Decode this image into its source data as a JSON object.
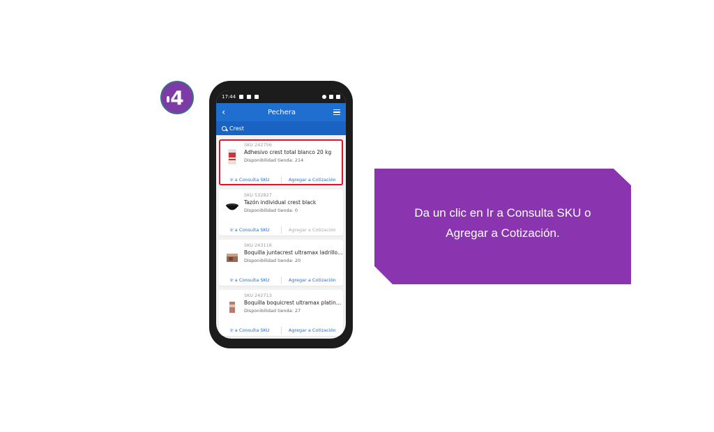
{
  "step": {
    "number": "4"
  },
  "phone": {
    "status": {
      "time": "17:44"
    },
    "app_title": "Pechera",
    "search_value": "Crest",
    "products": [
      {
        "sku": "SKU 242756",
        "name": "Adhesivo crest total blanco 20 kg",
        "stock": "Disponibilidad tienda: 214",
        "consulta": "Ir a Consulta SKU",
        "cotizacion": "Agregar a Cotización",
        "cotizacion_enabled": true,
        "highlighted": true,
        "thumb": "adhesive-bag-icon"
      },
      {
        "sku": "SKU 532827",
        "name": "Tazón individual crest black",
        "stock": "Disponibilidad tienda: 0",
        "consulta": "Ir a Consulta SKU",
        "cotizacion": "Agregar a Cotización",
        "cotizacion_enabled": false,
        "highlighted": false,
        "thumb": "bowl-icon"
      },
      {
        "sku": "SKU 243116",
        "name": "Boquilla juntacrest ultramax ladrillo 5...",
        "stock": "Disponibilidad tienda: 20",
        "consulta": "Ir a Consulta SKU",
        "cotizacion": "Agregar a Cotización",
        "cotizacion_enabled": true,
        "highlighted": false,
        "thumb": "grout-box-icon"
      },
      {
        "sku": "SKU 242713",
        "name": "Boquilla boquicrest ultramax platino ...",
        "stock": "Disponibilidad tienda: 27",
        "consulta": "Ir a Consulta SKU",
        "cotizacion": "Agregar a Cotización",
        "cotizacion_enabled": true,
        "highlighted": false,
        "thumb": "grout-bag-icon"
      }
    ]
  },
  "callout": {
    "line1": "Da un clic en Ir a Consulta SKU o",
    "line2": "Agregar a Cotización."
  },
  "colors": {
    "accent": "#1f6fd1",
    "callout": "#8a34b0",
    "highlight": "#e0112b",
    "badge": "#7e3aa6"
  }
}
